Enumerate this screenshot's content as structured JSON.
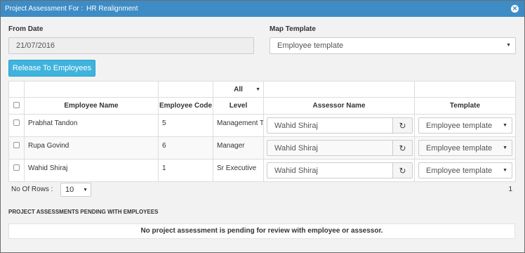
{
  "dialog": {
    "title_prefix": "Project Assessment For :",
    "title_project": "HR Realignment",
    "close_icon": "close-icon"
  },
  "form": {
    "from_date_label": "From Date",
    "from_date_value": "21/07/2016",
    "map_template_label": "Map Template",
    "map_template_value": "Employee template"
  },
  "release_button": "Release To Employees",
  "table": {
    "filter_level": "All",
    "headers": {
      "employee_name": "Employee Name",
      "employee_code": "Employee Code",
      "level": "Level",
      "assessor_name": "Assessor Name",
      "template": "Template"
    },
    "rows": [
      {
        "name": "Prabhat Tandon",
        "code": "5",
        "level": "Management Tra",
        "assessor": "Wahid Shiraj",
        "template": "Employee template"
      },
      {
        "name": "Rupa Govind",
        "code": "6",
        "level": "Manager",
        "assessor": "Wahid Shiraj",
        "template": "Employee template"
      },
      {
        "name": "Wahid Shiraj",
        "code": "1",
        "level": "Sr Executive",
        "assessor": "Wahid Shiraj",
        "template": "Employee template"
      }
    ]
  },
  "footer": {
    "rows_label": "No Of Rows :",
    "rows_value": "10",
    "page": "1"
  },
  "pending": {
    "title": "PROJECT ASSESSMENTS PENDING WITH EMPLOYEES",
    "message": "No project assessment is pending for review with employee or assessor."
  }
}
